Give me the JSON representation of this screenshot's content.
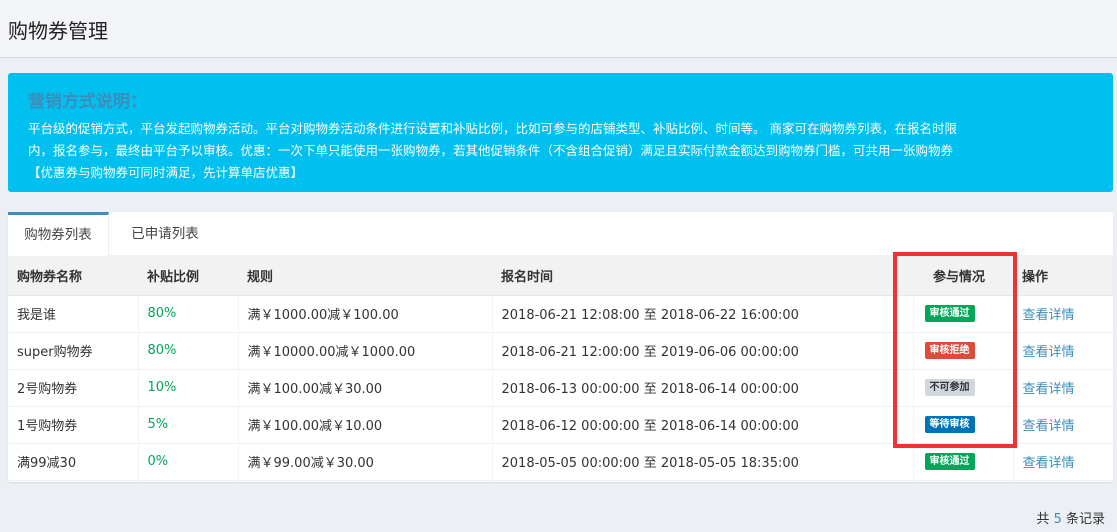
{
  "header": {
    "title": "购物券管理"
  },
  "info": {
    "heading": "营销方式说明：",
    "lines": [
      "平台级的促销方式，平台发起购物券活动。平台对购物券活动条件进行设置和补贴比例，比如可参与的店铺类型、补贴比例、时间等。 商家可在购物券列表，在报名时限",
      "内，报名参与，最终由平台予以审核。优惠：一次下单只能使用一张购物券，若其他促销条件（不含组合促销）满足且实际付款金额达到购物券门槛，可共用一张购物券",
      "【优惠券与购物券可同时满足，先计算单店优惠】"
    ]
  },
  "tabs": [
    {
      "label": "购物券列表",
      "active": true
    },
    {
      "label": "已申请列表",
      "active": false
    }
  ],
  "table": {
    "headers": [
      "购物券名称",
      "补贴比例",
      "规则",
      "报名时间",
      "参与情况",
      "操作"
    ],
    "rows": [
      {
        "name": "我是谁",
        "ratio": "80%",
        "rule": "满￥1000.00减￥100.00",
        "time": "2018-06-21 12:08:00 至 2018-06-22 16:00:00",
        "status": "审核通过",
        "status_color": "#00a65a",
        "action": "查看详情"
      },
      {
        "name": "super购物券",
        "ratio": "80%",
        "rule": "满￥10000.00减￥1000.00",
        "time": "2018-06-21 12:00:00 至 2019-06-06 00:00:00",
        "status": "审核拒绝",
        "status_color": "#dd4b39",
        "action": "查看详情"
      },
      {
        "name": "2号购物券",
        "ratio": "10%",
        "rule": "满￥100.00减￥30.00",
        "time": "2018-06-13 00:00:00 至 2018-06-14 00:00:00",
        "status": "不可参加",
        "status_color": "#d2d6de",
        "action": "查看详情"
      },
      {
        "name": "1号购物券",
        "ratio": "5%",
        "rule": "满￥100.00减￥10.00",
        "time": "2018-06-12 00:00:00 至 2018-06-14 00:00:00",
        "status": "等待审核",
        "status_color": "#0073b7",
        "action": "查看详情"
      },
      {
        "name": "满99减30",
        "ratio": "0%",
        "rule": "满￥99.00减￥30.00",
        "time": "2018-05-05 00:00:00 至 2018-05-05 18:35:00",
        "status": "审核通过",
        "status_color": "#00a65a",
        "action": "查看详情"
      }
    ]
  },
  "footer": {
    "prefix": "共",
    "count": "5",
    "suffix": "条记录"
  }
}
